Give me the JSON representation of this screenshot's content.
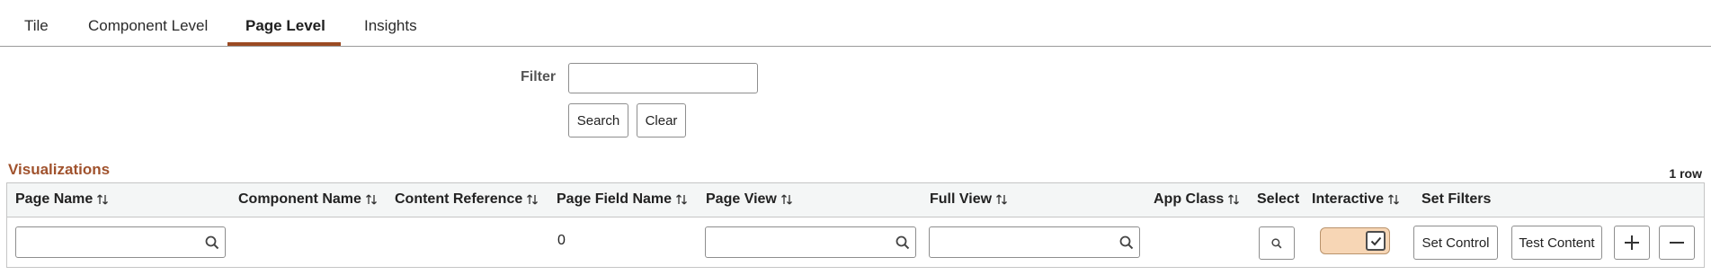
{
  "tabs": [
    {
      "label": "Tile"
    },
    {
      "label": "Component Level"
    },
    {
      "label": "Page Level"
    },
    {
      "label": "Insights"
    }
  ],
  "filter": {
    "label": "Filter",
    "value": "",
    "search_label": "Search",
    "clear_label": "Clear"
  },
  "section": {
    "title": "Visualizations",
    "row_count": "1 row"
  },
  "grid": {
    "headers": {
      "page_name": "Page Name",
      "component_name": "Component Name",
      "content_reference": "Content Reference",
      "page_field_name": "Page Field Name",
      "page_view": "Page View",
      "full_view": "Full View",
      "app_class": "App Class",
      "select": "Select",
      "interactive": "Interactive",
      "set_filters": "Set Filters"
    },
    "row": {
      "page_name": "",
      "page_field_name": "0",
      "page_view": "",
      "full_view": "",
      "interactive": true,
      "set_control_label": "Set Control",
      "test_content_label": "Test Content"
    }
  },
  "colors": {
    "accent": "#9b4a22",
    "section_title": "#a0522d",
    "toggle_bg": "#f7d6b5"
  }
}
